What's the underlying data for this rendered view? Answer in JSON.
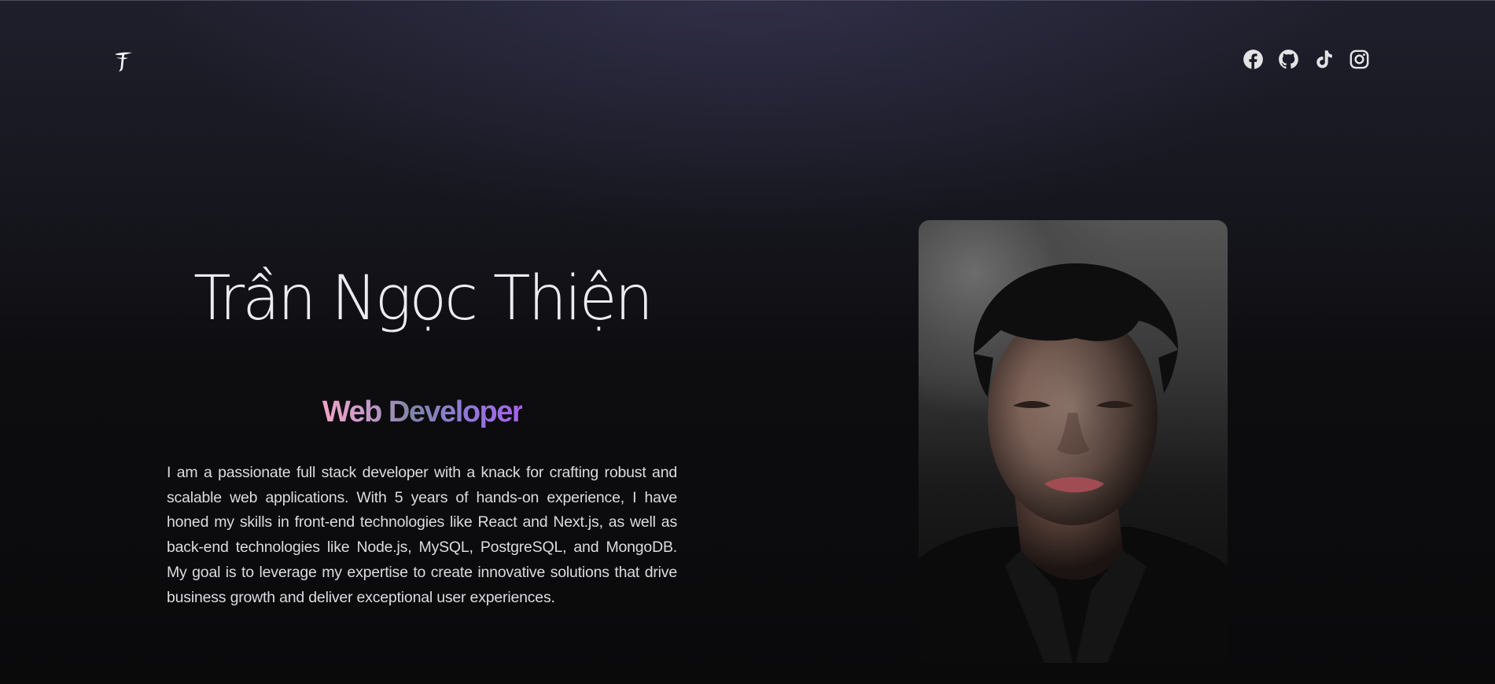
{
  "header": {
    "logo": {
      "icon": "tt-monogram-logo-icon"
    },
    "socials": [
      {
        "label": "Facebook",
        "icon": "facebook-icon"
      },
      {
        "label": "GitHub",
        "icon": "github-icon"
      },
      {
        "label": "TikTok",
        "icon": "tiktok-icon"
      },
      {
        "label": "Instagram",
        "icon": "instagram-icon"
      }
    ]
  },
  "hero": {
    "name": "Trần Ngọc Thiện",
    "role": "Web Developer",
    "bio": "I am a passionate full stack developer with a knack for crafting robust and scalable web applications. With 5 years of hands-on experience, I have honed my skills in front-end technologies like React and Next.js, as well as back-end technologies like Node.js, MySQL, PostgreSQL, and MongoDB. My goal is to leverage my expertise to create innovative solutions that drive business growth and deliver exceptional user experiences."
  },
  "colors": {
    "background_top": "#1f1f2c",
    "background_bottom": "#0a0a0b",
    "role_gradient": [
      "#f2a3c8",
      "#7f84a8",
      "#a860f0"
    ],
    "text": "#dcdce0"
  }
}
